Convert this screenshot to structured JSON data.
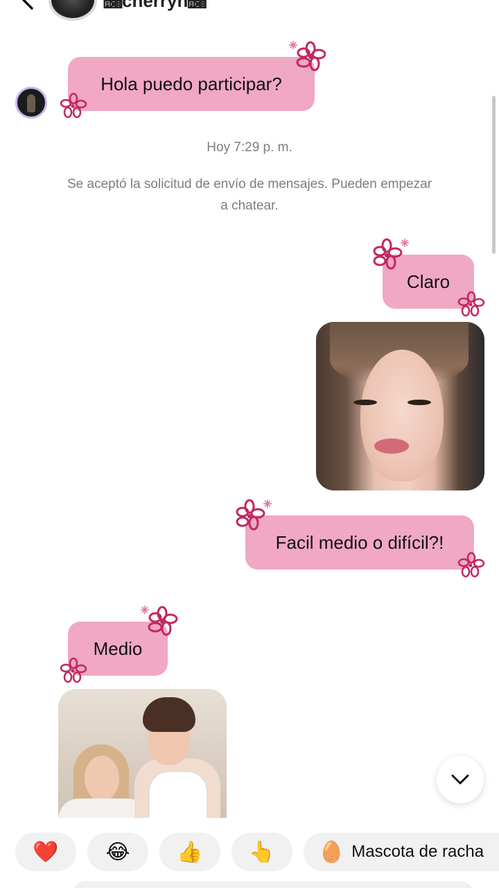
{
  "header": {
    "name": "🫈cherryn🫈"
  },
  "messages": {
    "incoming_1": "Hola puedo participar?",
    "timestamp": "Hoy 7:29 p. m.",
    "system_notice": "Se aceptó la solicitud de envío de mensajes. Pueden empezar a chatear.",
    "outgoing_1": "Claro",
    "outgoing_2": "Facil medio o difícil?!",
    "incoming_2": "Medio"
  },
  "quick_reactions": {
    "items": [
      "❤️",
      "😂",
      "👍",
      "👆"
    ],
    "streak_pet_emoji": "🥚",
    "streak_pet_label": "Mascota de racha"
  },
  "colors": {
    "bubble": "#f0a8c4",
    "flower": "#c2285f",
    "secondary_text": "#7d7d82"
  }
}
